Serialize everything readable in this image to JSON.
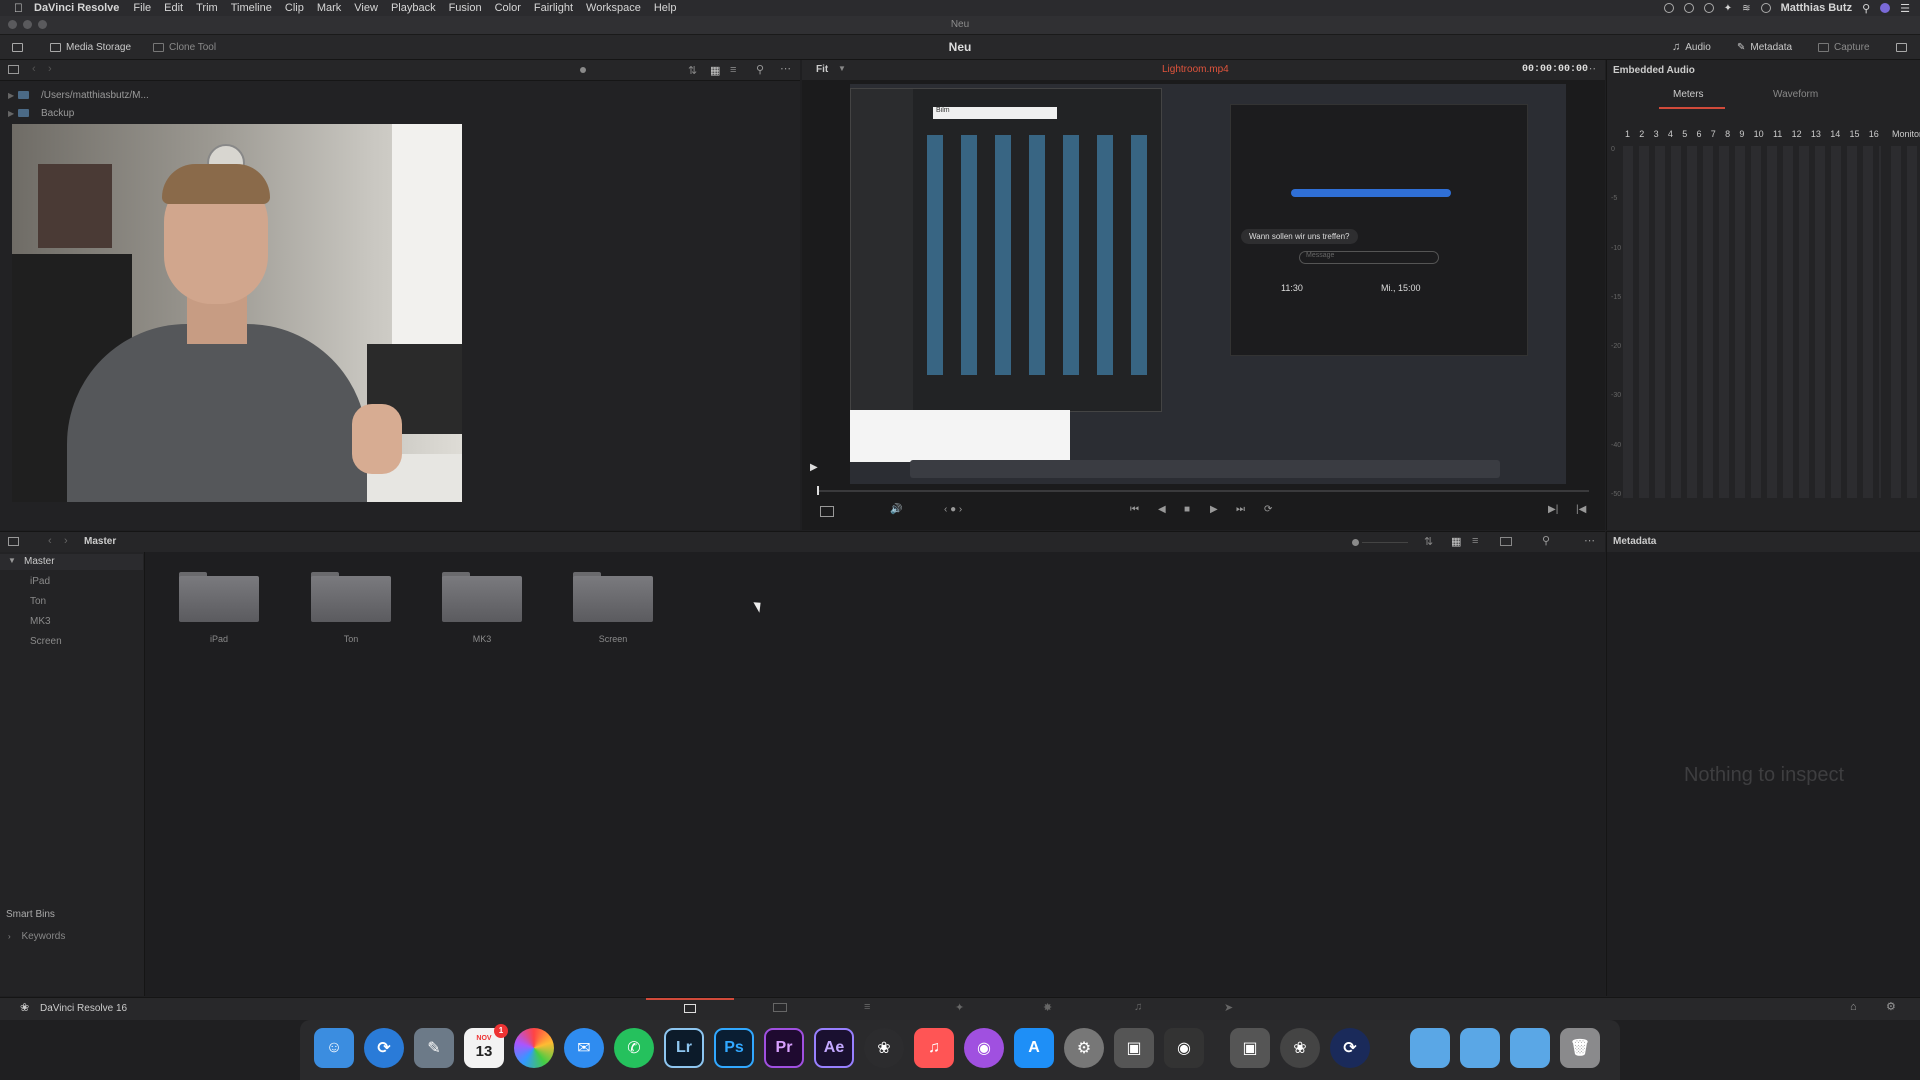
{
  "menubar": {
    "app_name": "DaVinci Resolve",
    "items": [
      "File",
      "Edit",
      "Trim",
      "Timeline",
      "Clip",
      "Mark",
      "View",
      "Playback",
      "Fusion",
      "Color",
      "Fairlight",
      "Workspace",
      "Help"
    ],
    "user": "Matthias Butz"
  },
  "window": {
    "title": "Neu"
  },
  "toolbar": {
    "media_storage": "Media Storage",
    "clone_tool": "Clone Tool",
    "project_title": "Neu",
    "audio": "Audio",
    "metadata": "Metadata",
    "capture": "Capture"
  },
  "storage": {
    "items": [
      {
        "label": "/Users/matthiasbutz/M..."
      },
      {
        "label": "Backup"
      }
    ]
  },
  "viewer": {
    "zoom": "Fit",
    "clip_name": "Lightroom.mp4",
    "timecode": "00:00:00:00",
    "screen_message": "Wann sollen wir uns treffen?",
    "screen_placeholder": "Message",
    "screen_time1": "11:30",
    "screen_time2": "Mi., 15:00",
    "screen_search": "Bilm"
  },
  "audio": {
    "title": "Embedded Audio",
    "tabs": [
      "Meters",
      "Waveform"
    ],
    "active_tab": "Meters",
    "channels": [
      "1",
      "2",
      "3",
      "4",
      "5",
      "6",
      "7",
      "8",
      "9",
      "10",
      "11",
      "12",
      "13",
      "14",
      "15",
      "16"
    ],
    "monitor_label": "Monitor",
    "scale": [
      "0",
      "-5",
      "-10",
      "-15",
      "-20",
      "-30",
      "-40",
      "-50"
    ]
  },
  "pool": {
    "breadcrumb": "Master",
    "master_label": "Master",
    "bins": [
      "iPad",
      "Ton",
      "MK3",
      "Screen"
    ],
    "folders": [
      "iPad",
      "Ton",
      "MK3",
      "Screen"
    ],
    "smart_bins_label": "Smart Bins",
    "keywords_label": "Keywords"
  },
  "metadata": {
    "title": "Metadata",
    "empty_text": "Nothing to inspect"
  },
  "pagebar": {
    "app_label": "DaVinci Resolve 16"
  },
  "dock": {
    "calendar_month": "NOV",
    "calendar_day": "13",
    "calendar_badge": "1",
    "lr": "Lr",
    "ps": "Ps",
    "pr": "Pr",
    "ae": "Ae"
  }
}
